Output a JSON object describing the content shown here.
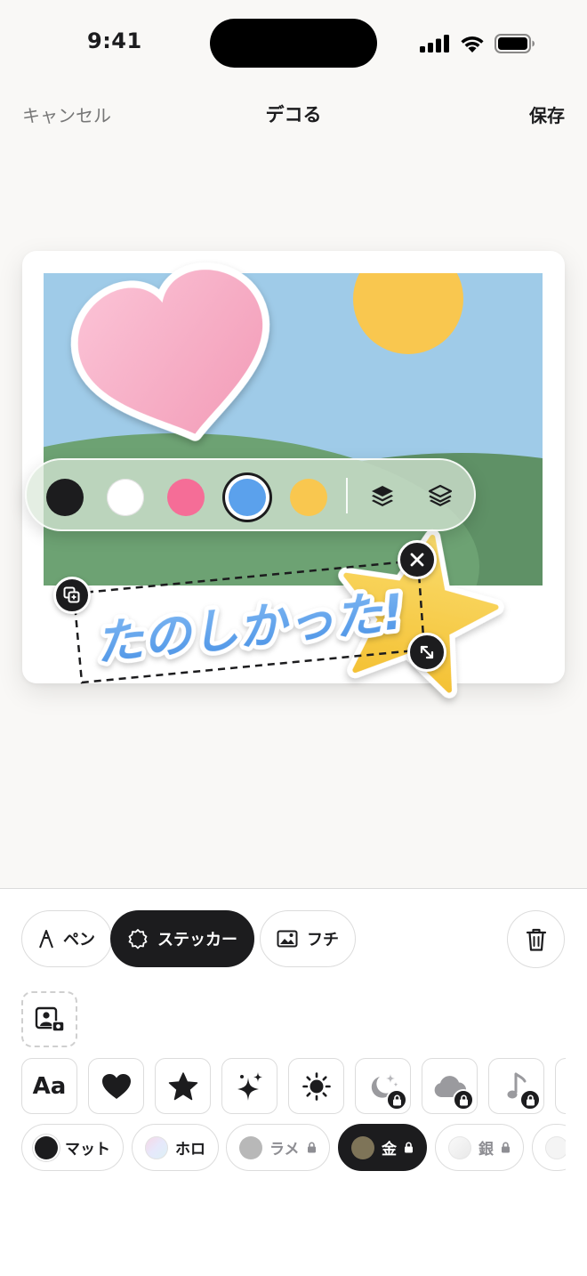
{
  "status": {
    "time": "9:41",
    "signal_icon": "cellular-signal-icon",
    "wifi_icon": "wifi-icon",
    "battery_icon": "battery-icon"
  },
  "nav": {
    "cancel": "キャンセル",
    "title": "デコる",
    "save": "保存"
  },
  "canvas": {
    "sticker_text": "たのしかった!",
    "colors": {
      "sky": "#9fcbe8",
      "sun": "#f9c74f",
      "hill_dark": "#5f9166",
      "hill_light": "#6da273",
      "heart": "#f5a3be",
      "star": "#f7cd4e",
      "text": "#5ba1ec"
    }
  },
  "color_toolbar": {
    "swatches": [
      {
        "name": "black",
        "color": "#1c1c1e",
        "selected": false
      },
      {
        "name": "white",
        "color": "#ffffff",
        "selected": false
      },
      {
        "name": "pink",
        "color": "#f56d97",
        "selected": false
      },
      {
        "name": "blue",
        "color": "#5ba1ec",
        "selected": true
      },
      {
        "name": "yellow",
        "color": "#f9c74f",
        "selected": false
      }
    ],
    "actions": [
      "bring-forward-icon",
      "send-backward-icon"
    ]
  },
  "handles": [
    "duplicate-icon",
    "close-icon",
    "resize-icon"
  ],
  "tools": {
    "tabs": [
      {
        "label": "ペン",
        "icon": "pen-icon",
        "active": false
      },
      {
        "label": "ステッカー",
        "icon": "sticker-icon",
        "active": true
      },
      {
        "label": "フチ",
        "icon": "frame-icon",
        "active": false
      }
    ],
    "trash_icon": "trash-icon"
  },
  "sticker_picker": {
    "upload_icon": "photo-upload-icon",
    "categories": [
      {
        "label": "Aa",
        "icon": "text-icon",
        "locked": false
      },
      {
        "icon": "heart-icon",
        "locked": false
      },
      {
        "icon": "star-icon",
        "locked": false
      },
      {
        "icon": "sparkle-icon",
        "locked": false
      },
      {
        "icon": "sun-icon",
        "locked": false
      },
      {
        "icon": "moon-icon",
        "locked": true
      },
      {
        "icon": "cloud-icon",
        "locked": true
      },
      {
        "icon": "music-note-icon",
        "locked": true
      },
      {
        "icon": "more-icon",
        "locked": false
      }
    ],
    "finishes": [
      {
        "label": "マット",
        "color": "#1c1c1e",
        "locked": false,
        "active": false
      },
      {
        "label": "ホロ",
        "color": "#f3e4f1",
        "locked": false,
        "active": false
      },
      {
        "label": "ラメ",
        "color": "#b8b8b8",
        "locked": true,
        "active": false
      },
      {
        "label": "金",
        "color": "#7e7458",
        "locked": true,
        "active": true
      },
      {
        "label": "銀",
        "color": "#f1f1f1",
        "locked": true,
        "active": false
      },
      {
        "label": "",
        "color": "#f4f4f4",
        "locked": false,
        "active": false
      }
    ]
  }
}
